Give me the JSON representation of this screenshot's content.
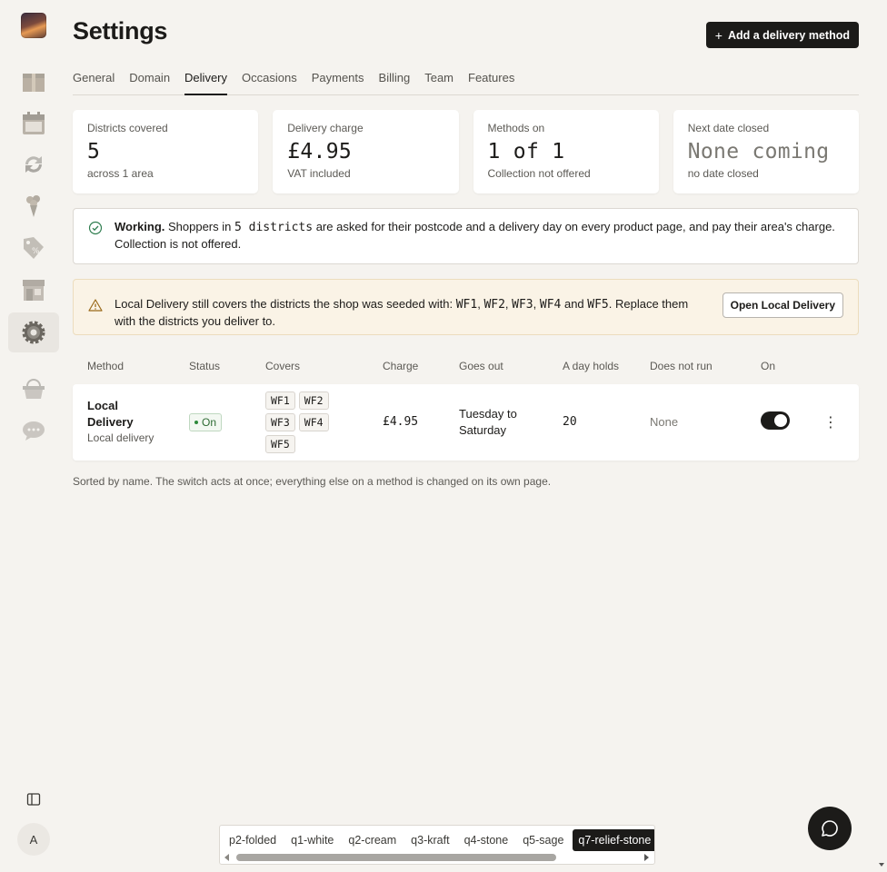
{
  "app": {
    "title": "Settings",
    "add_button_label": "Add a delivery method"
  },
  "sidebar": {
    "items": [
      {
        "icon": "box-icon"
      },
      {
        "icon": "calendar-icon"
      },
      {
        "icon": "refresh-icon"
      },
      {
        "icon": "bouquet-icon"
      },
      {
        "icon": "discount-tag-icon"
      },
      {
        "icon": "storefront-icon"
      },
      {
        "icon": "gear-icon",
        "active": true
      },
      {
        "icon": "basket-icon"
      },
      {
        "icon": "chat-bubble-icon"
      }
    ],
    "avatar_initial": "A"
  },
  "tabs": [
    {
      "label": "General"
    },
    {
      "label": "Domain"
    },
    {
      "label": "Delivery",
      "active": true
    },
    {
      "label": "Occasions"
    },
    {
      "label": "Payments"
    },
    {
      "label": "Billing"
    },
    {
      "label": "Team"
    },
    {
      "label": "Features"
    }
  ],
  "stats": [
    {
      "label": "Districts covered",
      "value": "5",
      "sub": "across 1 area"
    },
    {
      "label": "Delivery charge",
      "value": "£4.95",
      "sub": "VAT included"
    },
    {
      "label": "Methods on",
      "value": "1 of 1",
      "sub": "Collection not offered"
    },
    {
      "label": "Next date closed",
      "value": "None coming",
      "sub": "no date closed"
    }
  ],
  "status_banner": {
    "strong": "Working.",
    "text_pre": " Shoppers in ",
    "code": "5 districts",
    "text_post": " are asked for their postcode and a delivery day on every product page, and pay their area's charge. Collection is not offered."
  },
  "warning_banner": {
    "text_pre": "Local Delivery still covers the districts the shop was seeded with: ",
    "districts": [
      "WF1",
      "WF2",
      "WF3",
      "WF4",
      "WF5"
    ],
    "sep_comma": ", ",
    "sep_and": " and ",
    "text_post": ". Replace them with the districts you deliver to.",
    "button_label": "Open Local Delivery"
  },
  "table": {
    "headers": {
      "method": "Method",
      "status": "Status",
      "covers": "Covers",
      "charge": "Charge",
      "goes_out": "Goes out",
      "day_holds": "A day holds",
      "does_not_run": "Does not run",
      "on": "On"
    },
    "rows": [
      {
        "name": "Local Delivery",
        "sub": "Local delivery",
        "status": "On",
        "covers": [
          "WF1",
          "WF2",
          "WF3",
          "WF4",
          "WF5"
        ],
        "charge": "£4.95",
        "goes_out": "Tuesday to Saturday",
        "day_holds": "20",
        "does_not_run": "None",
        "enabled": true
      }
    ],
    "footnote": "Sorted by name. The switch acts at once; everything else on a method is changed on its own page."
  },
  "theme_bar": {
    "items": [
      "p2-folded",
      "q1-white",
      "q2-cream",
      "q3-kraft",
      "q4-stone",
      "q5-sage",
      "q7-relief-stone"
    ],
    "active": "q7-relief-stone",
    "scroll_position": 0.72
  },
  "colors": {
    "background": "#f5f3ef",
    "primary": "#1c1b19",
    "success": "#2e8a3b",
    "warning_bg": "#faf3e6",
    "warning_icon": "#9a6a1a"
  }
}
